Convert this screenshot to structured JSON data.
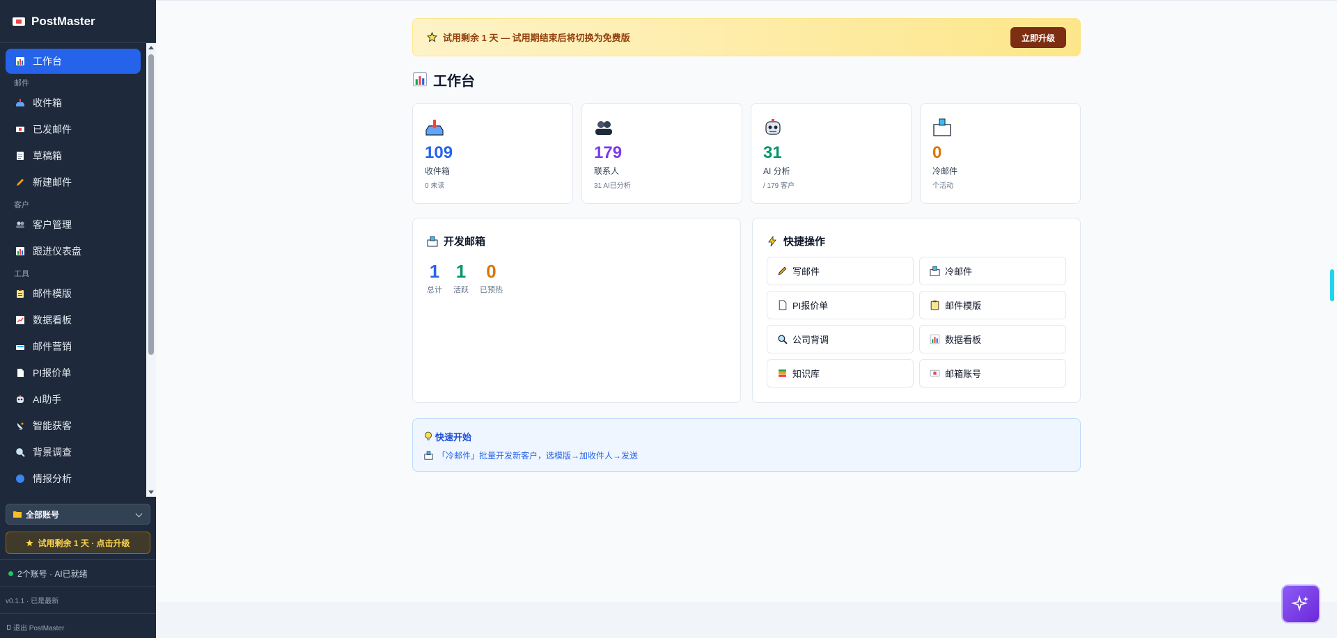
{
  "app": {
    "name": "PostMaster",
    "version": "v0.1.1 · 已是最新",
    "logout": "退出 PostMaster"
  },
  "sidebar": {
    "dashboard": "工作台",
    "sections": {
      "mail": "邮件",
      "customers": "客户",
      "tools": "工具"
    },
    "mail_items": [
      "收件箱",
      "已发邮件",
      "草稿箱",
      "新建邮件"
    ],
    "customer_items": [
      "客户管理",
      "跟进仪表盘"
    ],
    "tool_items": [
      "邮件模版",
      "数据看板",
      "邮件营销",
      "PI报价单",
      "AI助手",
      "智能获客",
      "背景调查",
      "情报分析"
    ],
    "account_select": "全部账号",
    "trial_button": "试用剩余 1 天 · 点击升级",
    "status": "2个账号 · AI已就绪"
  },
  "banner": {
    "text": "试用剩余 1 天 — 试用期结束后将切换为免费版",
    "button": "立即升级"
  },
  "page": {
    "title": "工作台"
  },
  "stats": [
    {
      "value": "109",
      "label": "收件箱",
      "sub": "0 未读",
      "color": "#2563eb"
    },
    {
      "value": "179",
      "label": "联系人",
      "sub": "31 AI已分析",
      "color": "#7c3aed"
    },
    {
      "value": "31",
      "label": "AI 分析",
      "sub": "/ 179 客户",
      "color": "#059669"
    },
    {
      "value": "0",
      "label": "冷邮件",
      "sub": "个活动",
      "color": "#d97706"
    }
  ],
  "mailbox": {
    "title": "开发邮箱",
    "stats": [
      {
        "value": "1",
        "label": "总计",
        "color": "#2563eb"
      },
      {
        "value": "1",
        "label": "活跃",
        "color": "#059669"
      },
      {
        "value": "0",
        "label": "已预热",
        "color": "#d97706"
      }
    ]
  },
  "quick_actions": {
    "title": "快捷操作",
    "items": [
      "写邮件",
      "冷邮件",
      "PI报价单",
      "邮件模版",
      "公司背调",
      "数据看板",
      "知识库",
      "邮箱账号"
    ]
  },
  "quickstart": {
    "title": "快速开始",
    "text": "「冷邮件」批量开发新客户，选模版→加收件人→发送"
  }
}
